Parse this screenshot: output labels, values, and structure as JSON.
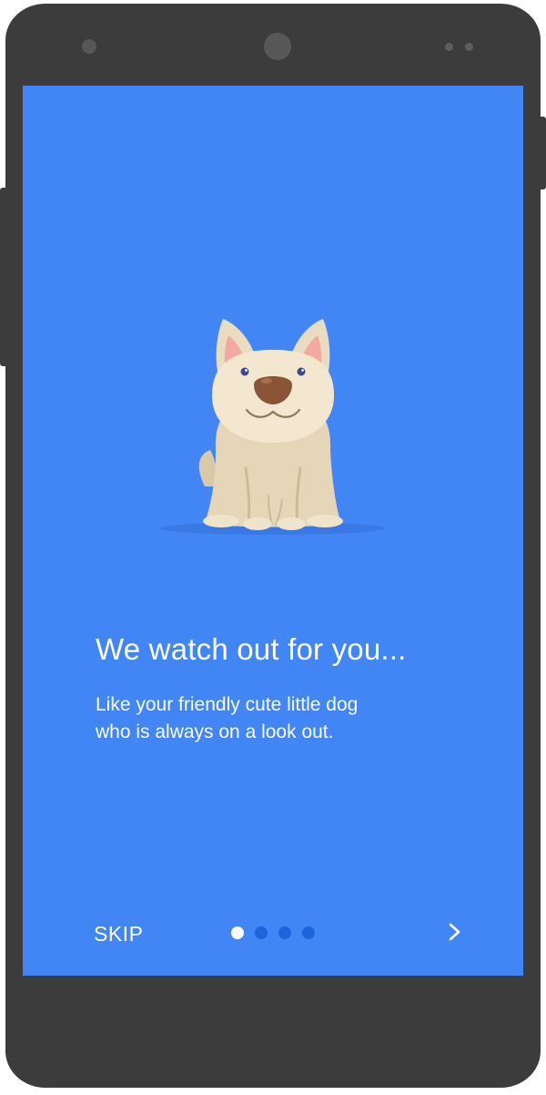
{
  "onboarding": {
    "title": "We watch out for you...",
    "subtitle_line1": "Like your friendly cute little dog",
    "subtitle_line2": "who is always on a look out.",
    "skip_label": "SKIP",
    "page_indicator": {
      "current": 1,
      "total": 4
    },
    "next_icon": "chevron-right-icon",
    "illustration": "dog-illustration"
  },
  "colors": {
    "screen_background": "#4285f4",
    "device_body": "#3c3c3c",
    "inactive_dot": "#1e64dc",
    "active_dot": "#ffffff",
    "text": "#ffffff"
  }
}
